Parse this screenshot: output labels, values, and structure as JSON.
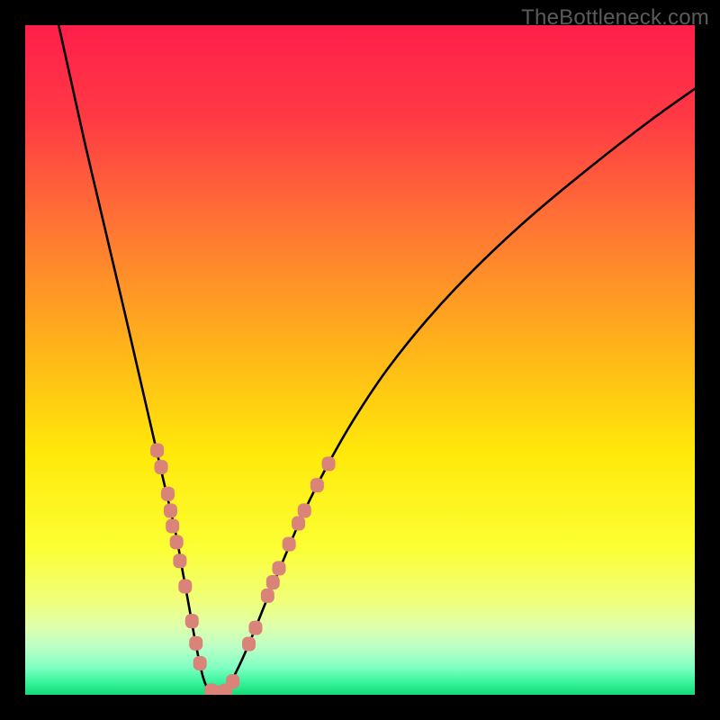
{
  "watermark": "TheBottleneck.com",
  "chart_data": {
    "type": "line",
    "title": "",
    "xlabel": "",
    "ylabel": "",
    "xlim": [
      0,
      100
    ],
    "ylim": [
      0,
      100
    ],
    "legend": false,
    "background_gradient": {
      "type": "vertical",
      "stops": [
        {
          "pct": 0,
          "color": "#ff1f4b"
        },
        {
          "pct": 14,
          "color": "#ff3a44"
        },
        {
          "pct": 30,
          "color": "#ff7534"
        },
        {
          "pct": 48,
          "color": "#ffb31a"
        },
        {
          "pct": 64,
          "color": "#ffe90a"
        },
        {
          "pct": 78,
          "color": "#fcff34"
        },
        {
          "pct": 86,
          "color": "#f0ff7a"
        },
        {
          "pct": 90,
          "color": "#ddffae"
        },
        {
          "pct": 93,
          "color": "#b9ffc7"
        },
        {
          "pct": 96,
          "color": "#7dffc1"
        },
        {
          "pct": 98,
          "color": "#3cf59e"
        },
        {
          "pct": 100,
          "color": "#14d977"
        }
      ]
    },
    "series": [
      {
        "name": "bottleneck-curve",
        "color": "#000000",
        "x": [
          5,
          7,
          9,
          11,
          13,
          15,
          16.5,
          18,
          19.5,
          21,
          22.5,
          23.5,
          24.5,
          25.3,
          26,
          26.6,
          27.2,
          27.8,
          28.5,
          29.3,
          30.2,
          31.2,
          32.5,
          34,
          36,
          38.5,
          41.5,
          45,
          49,
          54,
          60,
          67,
          75,
          84,
          93,
          100
        ],
        "y": [
          100,
          91,
          82,
          73.5,
          65,
          56.5,
          50,
          43.5,
          37,
          30.5,
          24,
          18.5,
          13,
          8.5,
          5,
          2.5,
          1,
          0.3,
          0,
          0.2,
          1,
          2.8,
          5.5,
          9,
          14,
          20,
          27,
          34,
          41,
          48.5,
          56,
          63.5,
          71,
          78.5,
          85.5,
          90.5
        ]
      }
    ],
    "markers": [
      {
        "name": "left-branch-markers",
        "shape": "rounded-rect",
        "color": "#d98379",
        "points": [
          {
            "x": 19.7,
            "y": 36.5
          },
          {
            "x": 20.3,
            "y": 34.0
          },
          {
            "x": 21.3,
            "y": 30.0
          },
          {
            "x": 21.7,
            "y": 27.5
          },
          {
            "x": 22.0,
            "y": 25.2
          },
          {
            "x": 22.6,
            "y": 22.8
          },
          {
            "x": 23.1,
            "y": 20.0
          },
          {
            "x": 23.9,
            "y": 16.2
          },
          {
            "x": 24.9,
            "y": 11.0
          },
          {
            "x": 25.5,
            "y": 7.7
          },
          {
            "x": 26.1,
            "y": 4.7
          }
        ]
      },
      {
        "name": "bottom-markers",
        "shape": "rounded-rect",
        "color": "#d98379",
        "points": [
          {
            "x": 27.8,
            "y": 0.6
          },
          {
            "x": 28.9,
            "y": 0.3
          },
          {
            "x": 29.9,
            "y": 0.6
          },
          {
            "x": 31.0,
            "y": 2.0
          }
        ]
      },
      {
        "name": "right-branch-markers",
        "shape": "rounded-rect",
        "color": "#d98379",
        "points": [
          {
            "x": 33.4,
            "y": 7.6
          },
          {
            "x": 34.4,
            "y": 10.0
          },
          {
            "x": 36.2,
            "y": 14.8
          },
          {
            "x": 37.0,
            "y": 16.8
          },
          {
            "x": 37.9,
            "y": 18.9
          },
          {
            "x": 39.4,
            "y": 22.5
          },
          {
            "x": 40.8,
            "y": 25.6
          },
          {
            "x": 41.7,
            "y": 27.5
          },
          {
            "x": 43.6,
            "y": 31.3
          },
          {
            "x": 45.3,
            "y": 34.5
          }
        ]
      }
    ]
  }
}
